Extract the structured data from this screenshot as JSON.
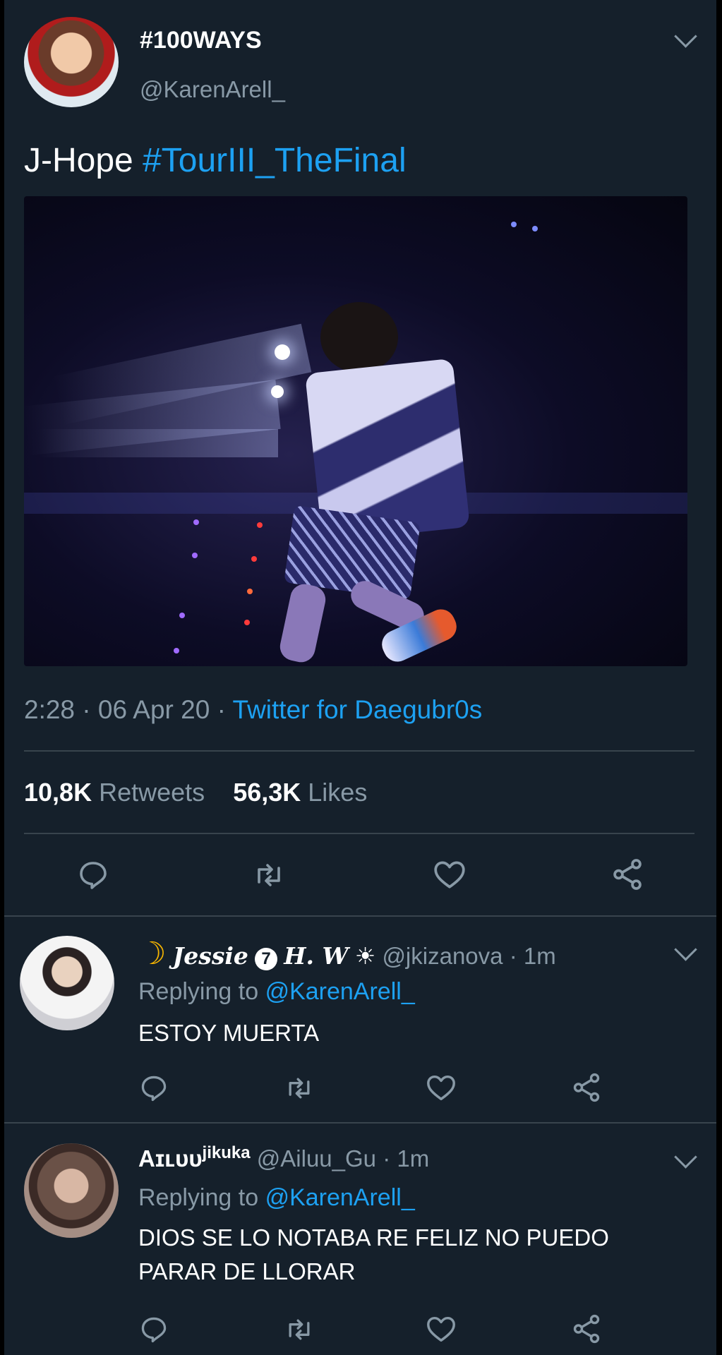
{
  "main_tweet": {
    "display_name": "#100WAYS",
    "handle": "@KarenArell_",
    "text_plain": "J-Hope ",
    "text_hashtag": "#TourIII_TheFinal",
    "time": "2:28",
    "date": "06 Apr 20",
    "source": "Twitter for Daegubr0s",
    "retweets_count": "10,8K",
    "retweets_label": "Retweets",
    "likes_count": "56,3K",
    "likes_label": "Likes"
  },
  "replies": [
    {
      "display_name_moon": "☽",
      "display_name_fancy": "Jessie",
      "display_name_badge": "7",
      "display_name_extra": "H. W",
      "display_name_sun": "☀",
      "handle": "@jkizanova",
      "time": "1m",
      "replying_label": "Replying to",
      "replying_handle": "@KarenArell_",
      "text": "ESTOY MUERTA"
    },
    {
      "display_name": "Aɪʟᴜᴜ",
      "display_name_sup": "jikuka",
      "handle": "@Ailuu_Gu",
      "time": "1m",
      "replying_label": "Replying to",
      "replying_handle": "@KarenArell_",
      "text_line1": "DIOS SE LO NOTABA RE FELIZ NO PUEDO",
      "text_line2": "PARAR DE LLORAR"
    }
  ],
  "icons": {
    "reply": "reply-icon",
    "retweet": "retweet-icon",
    "like": "heart-icon",
    "share": "share-icon",
    "more": "chevron-down-icon"
  },
  "colors": {
    "background": "#15202b",
    "accent": "#1da1f2",
    "muted": "#8899a6",
    "divider": "#38444d"
  }
}
